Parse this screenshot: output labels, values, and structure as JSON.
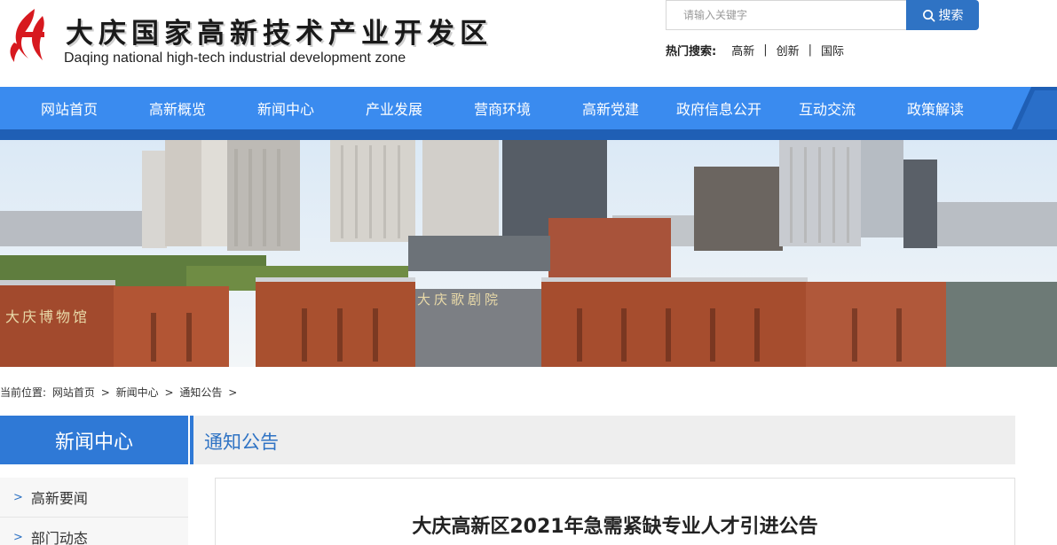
{
  "header": {
    "title": "大庆国家高新技术产业开发区",
    "subtitle": "Daqing national high-tech industrial development zone",
    "logo_icon": "flame-logo-icon"
  },
  "search": {
    "placeholder": "请输入关键字",
    "button_label": "搜索",
    "icon": "search-icon"
  },
  "hot_search": {
    "label": "热门搜索:",
    "items": [
      "高新",
      "创新",
      "国际"
    ]
  },
  "nav": {
    "items": [
      "网站首页",
      "高新概览",
      "新闻中心",
      "产业发展",
      "营商环境",
      "高新党建",
      "政府信息公开",
      "互动交流",
      "政策解读"
    ]
  },
  "banner": {
    "signs": [
      "大庆歌剧院",
      "大庆博物馆"
    ]
  },
  "breadcrumb": {
    "prefix": "当前位置:",
    "items": [
      "网站首页",
      "新闻中心",
      "通知公告"
    ],
    "separator": ">"
  },
  "sidebar": {
    "heading": "新闻中心",
    "items": [
      {
        "label": "高新要闻"
      },
      {
        "label": "部门动态"
      }
    ]
  },
  "main": {
    "category": "通知公告",
    "article_title": "大庆高新区2021年急需紧缺专业人才引进公告"
  },
  "colors": {
    "nav_blue": "#3a8bef",
    "nav_dark": "#1f5fb5",
    "accent": "#2f73c4",
    "logo_red": "#d7191f"
  }
}
